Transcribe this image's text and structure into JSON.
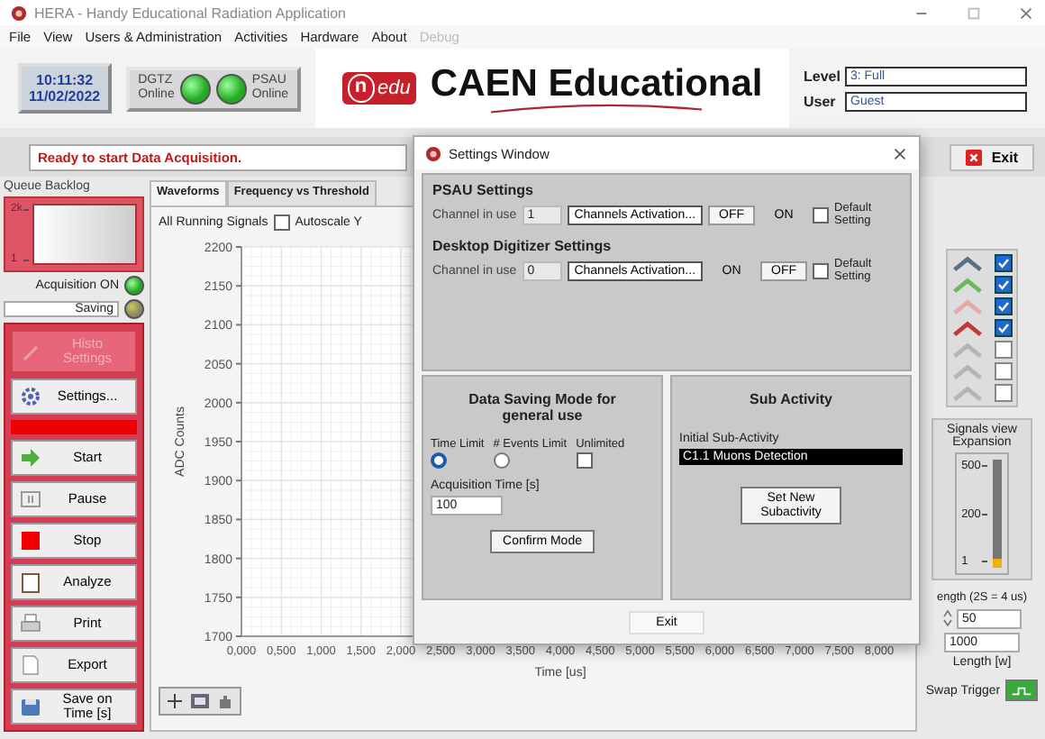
{
  "window": {
    "title": "HERA - Handy Educational Radiation Application"
  },
  "menu": [
    {
      "label": "File",
      "disabled": false
    },
    {
      "label": "View",
      "disabled": false
    },
    {
      "label": "Users & Administration",
      "disabled": false
    },
    {
      "label": "Activities",
      "disabled": false
    },
    {
      "label": "Hardware",
      "disabled": false
    },
    {
      "label": "About",
      "disabled": false
    },
    {
      "label": "Debug",
      "disabled": true
    }
  ],
  "header": {
    "time": "10:11:32",
    "date": "11/02/2022",
    "indicators": [
      {
        "name": "DGTZ",
        "status": "Online",
        "on": true
      },
      {
        "name": "PSAU",
        "status": "Online",
        "on": true
      }
    ],
    "logo": {
      "mark": "n",
      "badge": "edu",
      "title": "CAEN Educational"
    },
    "level": {
      "label": "Level",
      "value": "3: Full"
    },
    "user": {
      "label": "User",
      "value": "Guest"
    }
  },
  "status_message": "Ready to start Data Acquisition.",
  "exit_button": "Exit",
  "left_panel": {
    "queue_label": "Queue Backlog",
    "queue_ticks": [
      "2k",
      "1"
    ],
    "acquisition": {
      "label": "Acquisition ON",
      "on": true
    },
    "saving": {
      "label": "Saving",
      "on": false
    },
    "buttons": [
      {
        "label": "Histo Settings",
        "kind": "pencil",
        "disabled": true
      },
      {
        "label": "Settings...",
        "kind": "gear",
        "disabled": false
      },
      {
        "label": "Start",
        "kind": "start",
        "disabled": false
      },
      {
        "label": "Pause",
        "kind": "pause",
        "disabled": false
      },
      {
        "label": "Stop",
        "kind": "stop",
        "disabled": false
      },
      {
        "label": "Analyze",
        "kind": "clipboard",
        "disabled": false
      },
      {
        "label": "Print",
        "kind": "printer",
        "disabled": false
      },
      {
        "label": "Export",
        "kind": "document",
        "disabled": false
      },
      {
        "label": "Save on Time [s]",
        "kind": "disk",
        "disabled": false
      }
    ]
  },
  "tabs": [
    {
      "label": "Waveforms",
      "selected": true
    },
    {
      "label": "Frequency vs Threshold",
      "selected": false
    }
  ],
  "signals_label": "All Running Signals",
  "autoscale": {
    "label": "Autoscale Y",
    "checked": false
  },
  "chart_data": {
    "type": "line",
    "xlabel": "Time [us]",
    "ylabel": "ADC Counts",
    "xlim": [
      0,
      8
    ],
    "ylim": [
      1700,
      2200
    ],
    "xticks": [
      {
        "value": 0,
        "label": "0,000"
      },
      {
        "value": 0.5,
        "label": "0,500"
      },
      {
        "value": 1,
        "label": "1,000"
      },
      {
        "value": 1.5,
        "label": "1,500"
      },
      {
        "value": 2,
        "label": "2,000"
      },
      {
        "value": 2.5,
        "label": "2,500"
      },
      {
        "value": 3,
        "label": "3,000"
      },
      {
        "value": 3.5,
        "label": "3,500"
      },
      {
        "value": 4,
        "label": "4,000"
      },
      {
        "value": 4.5,
        "label": "4,500"
      },
      {
        "value": 5,
        "label": "5,000"
      },
      {
        "value": 5.5,
        "label": "5,500"
      },
      {
        "value": 6,
        "label": "6,000"
      },
      {
        "value": 6.5,
        "label": "6,500"
      },
      {
        "value": 7,
        "label": "7,000"
      },
      {
        "value": 7.5,
        "label": "7,500"
      },
      {
        "value": 8,
        "label": "8,000"
      }
    ],
    "grid": true,
    "yticks": [
      1700,
      1750,
      1800,
      1850,
      1900,
      1950,
      2000,
      2050,
      2100,
      2150,
      2200
    ]
  },
  "right_panel": {
    "signals": [
      {
        "color": "#5a7088",
        "checked": true
      },
      {
        "color": "#6cb85c",
        "checked": true
      },
      {
        "color": "#e8a8a8",
        "checked": true
      },
      {
        "color": "#c03838",
        "checked": true
      },
      {
        "color": "#b4b4b4",
        "checked": false
      },
      {
        "color": "#b4b4b4",
        "checked": false
      },
      {
        "color": "#b4b4b4",
        "checked": false
      }
    ],
    "expansion": {
      "title": "Signals view Expansion",
      "ticks": [
        "500",
        "200",
        "1"
      ],
      "level": 0.08
    },
    "length_caption": "ength (2S = 4 us)",
    "length_value": "50",
    "length_samples": "1000",
    "length_label": "Length [w]",
    "swap_trigger": {
      "label": "Swap Trigger",
      "on": true
    }
  },
  "dialog": {
    "title": "Settings Window",
    "sections": [
      {
        "title": "PSAU Settings",
        "channel_label": "Channel in use",
        "channel": "1",
        "activation": "Channels Activation...",
        "toggles": [
          {
            "label": "OFF",
            "selected": true
          },
          {
            "label": "ON",
            "selected": false
          }
        ],
        "default": {
          "label": "Default Setting",
          "checked": false
        }
      },
      {
        "title": "Desktop Digitizer Settings",
        "channel_label": "Channel in use",
        "channel": "0",
        "activation": "Channels Activation...",
        "toggles": [
          {
            "label": "ON",
            "selected": false
          },
          {
            "label": "OFF",
            "selected": true
          }
        ],
        "default": {
          "label": "Default Setting",
          "checked": false
        }
      }
    ],
    "saving_mode": {
      "title": "Data Saving Mode for general use",
      "options": [
        {
          "label": "Time Limit",
          "kind": "radio",
          "selected": true
        },
        {
          "label": "# Events Limit",
          "kind": "radio",
          "selected": false
        },
        {
          "label": "Unlimited",
          "kind": "checkbox",
          "selected": false
        }
      ],
      "time_label": "Acquisition Time [s]",
      "time_value": "100",
      "confirm": "Confirm Mode"
    },
    "sub_activity": {
      "title": "Sub Activity",
      "label": "Initial Sub-Activity",
      "value": "C1.1 Muons Detection",
      "button": "Set New Subactivity"
    },
    "exit": "Exit"
  }
}
